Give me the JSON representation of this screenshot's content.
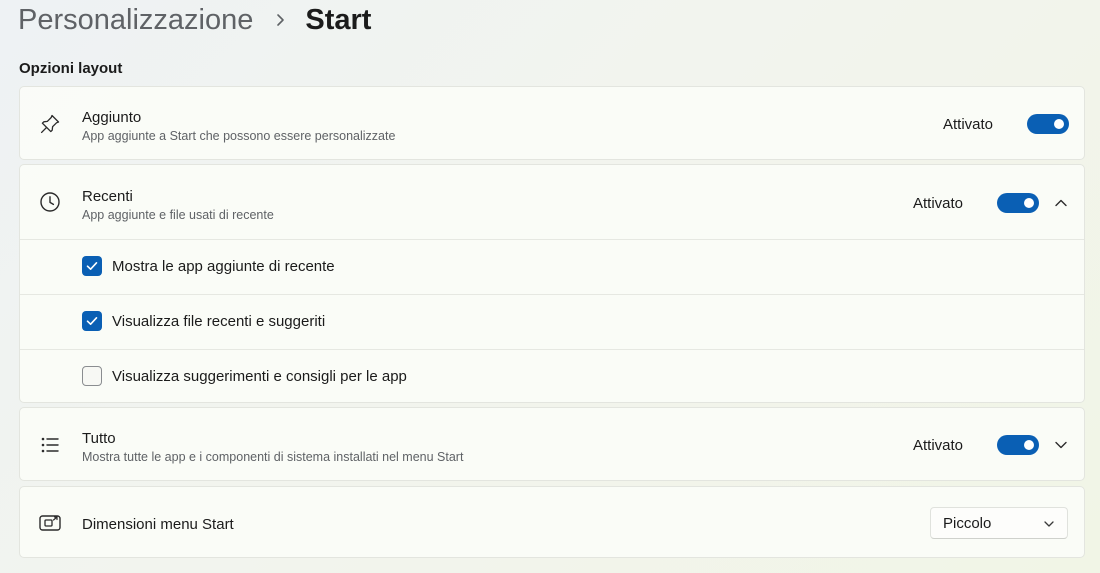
{
  "breadcrumb": {
    "parent": "Personalizzazione",
    "current": "Start"
  },
  "section": {
    "label": "Opzioni layout"
  },
  "pinned": {
    "title": "Aggiunto",
    "subtitle": "App aggiunte a Start che possono essere personalizzate",
    "state": "Attivato",
    "on": true,
    "icon": "pin-icon"
  },
  "recent": {
    "title": "Recenti",
    "subtitle": "App aggiunte e file usati di recente",
    "state": "Attivato",
    "on": true,
    "expanded": true,
    "icon": "clock-icon",
    "options": [
      {
        "label": "Mostra le app aggiunte di recente",
        "checked": true
      },
      {
        "label": "Visualizza file recenti e suggeriti",
        "checked": true
      },
      {
        "label": "Visualizza suggerimenti e consigli per le app",
        "checked": false
      }
    ]
  },
  "all": {
    "title": "Tutto",
    "subtitle": "Mostra tutte le app e i componenti di sistema installati nel menu Start",
    "state": "Attivato",
    "on": true,
    "expanded": false,
    "icon": "list-icon"
  },
  "size": {
    "title": "Dimensioni menu Start",
    "value": "Piccolo",
    "icon": "start-menu-size-icon"
  },
  "colors": {
    "accent": "#0a5fb4"
  }
}
